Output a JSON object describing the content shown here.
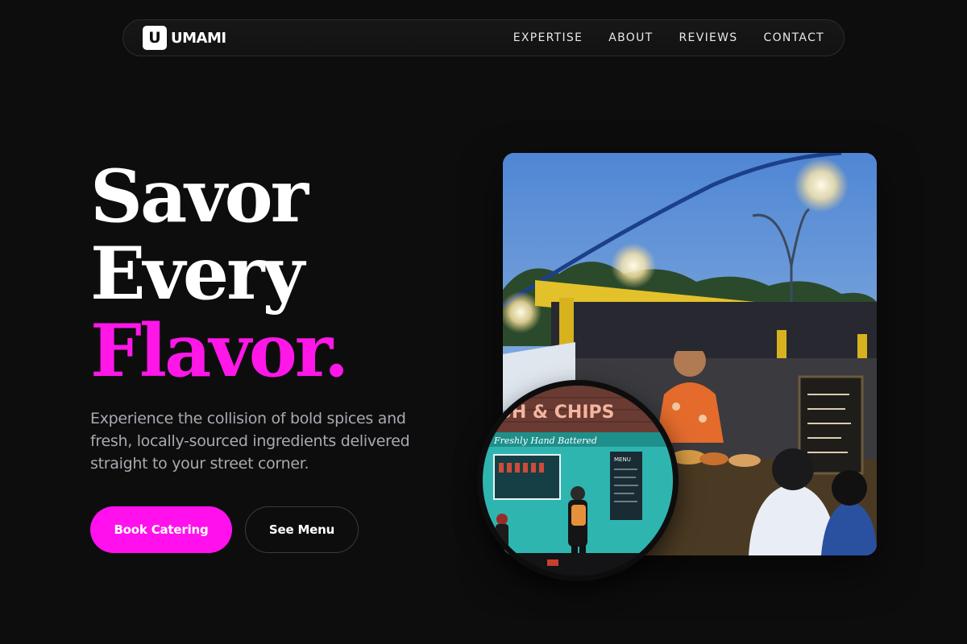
{
  "nav": {
    "logo_letter": "U",
    "brand": "UMAMI",
    "links": [
      "EXPERTISE",
      "ABOUT",
      "REVIEWS",
      "CONTACT"
    ]
  },
  "hero": {
    "line1": "Savor",
    "line2": "Every",
    "line3": "Flavor.",
    "subtext": "Experience the collision of bold spices and fresh, locally-sourced ingredients delivered straight to your street corner.",
    "primary_cta": "Book Catering",
    "secondary_cta": "See Menu"
  },
  "images": {
    "main_alt": "Food stall vendor serving customers under string lights",
    "round_alt": "Turquoise fish and chips food truck",
    "round_sign": "SH & CHIPS",
    "round_script": "Freshly Hand Battered",
    "round_menu": "MENU"
  },
  "colors": {
    "accent": "#ff17e8",
    "background": "#0d0d0e",
    "muted_text": "#a9a9b1"
  }
}
